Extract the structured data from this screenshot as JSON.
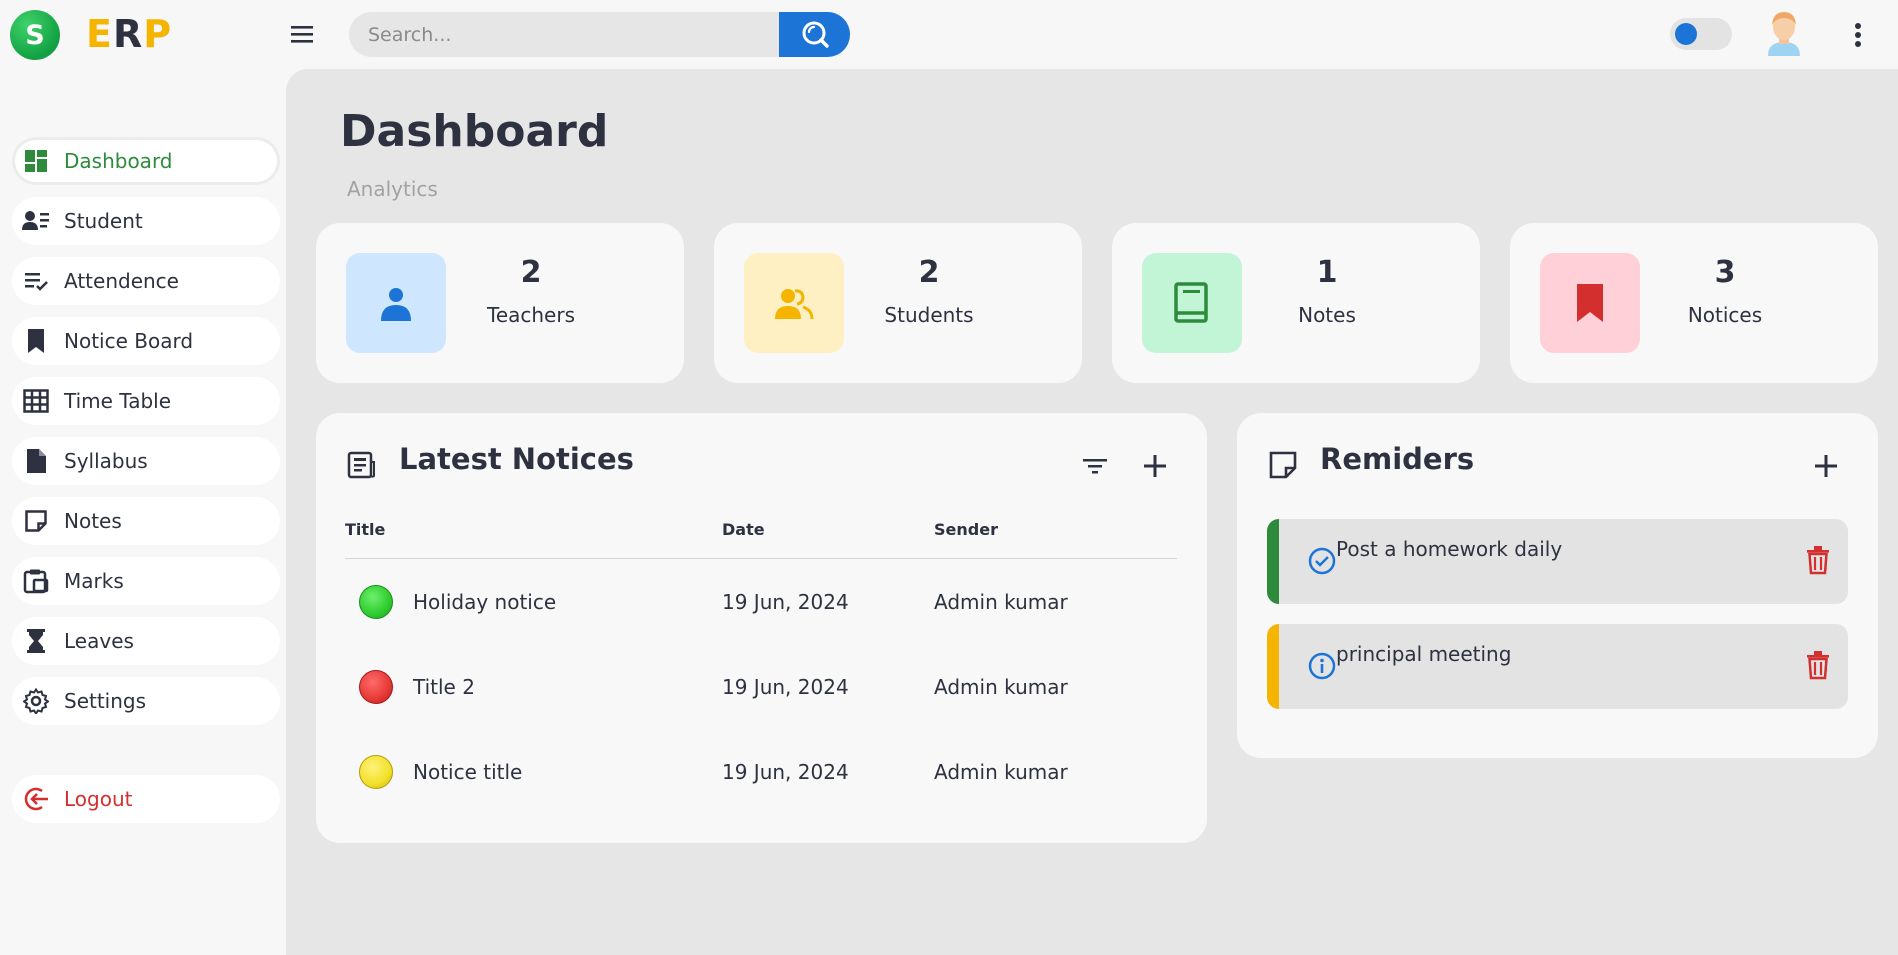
{
  "brand": {
    "logo_letter": "S",
    "name_e": "E",
    "name_r": "R",
    "name_p": "P"
  },
  "search": {
    "placeholder": "Search..."
  },
  "sidebar": {
    "items": [
      {
        "label": "Dashboard",
        "icon": "dashboard-icon",
        "active": true
      },
      {
        "label": "Student",
        "icon": "student-list-icon"
      },
      {
        "label": "Attendence",
        "icon": "checklist-icon"
      },
      {
        "label": "Notice Board",
        "icon": "bookmark-icon"
      },
      {
        "label": "Time Table",
        "icon": "table-icon"
      },
      {
        "label": "Syllabus",
        "icon": "document-icon"
      },
      {
        "label": "Notes",
        "icon": "sticky-note-icon"
      },
      {
        "label": "Marks",
        "icon": "clipboard-icon"
      },
      {
        "label": "Leaves",
        "icon": "hourglass-icon"
      },
      {
        "label": "Settings",
        "icon": "gear-icon"
      }
    ],
    "logout": {
      "label": "Logout",
      "icon": "logout-icon"
    }
  },
  "page": {
    "title": "Dashboard",
    "subtitle": "Analytics"
  },
  "stats": [
    {
      "value": "2",
      "label": "Teachers",
      "icon": "person-icon",
      "bg": "#cfe6ff",
      "fg": "#1d74d7"
    },
    {
      "value": "2",
      "label": "Students",
      "icon": "group-icon",
      "bg": "#fff0c4",
      "fg": "#f4b400"
    },
    {
      "value": "1",
      "label": "Notes",
      "icon": "book-icon",
      "bg": "#c1f5d5",
      "fg": "#2e8b3b"
    },
    {
      "value": "3",
      "label": "Notices",
      "icon": "bookmark-icon",
      "bg": "#ffd0d8",
      "fg": "#d32f2f"
    }
  ],
  "notices": {
    "title": "Latest Notices",
    "columns": {
      "title": "Title",
      "date": "Date",
      "sender": "Sender"
    },
    "rows": [
      {
        "title": "Holiday notice",
        "date": "19 Jun, 2024",
        "sender": "Admin kumar",
        "status_color": "#2ecc2e"
      },
      {
        "title": "Title 2",
        "date": "19 Jun, 2024",
        "sender": "Admin kumar",
        "status_color": "#e53935"
      },
      {
        "title": "Notice title",
        "date": "19 Jun, 2024",
        "sender": "Admin kumar",
        "status_color": "#f2e02a"
      }
    ]
  },
  "reminders": {
    "title": "Remiders",
    "items": [
      {
        "text": "Post a homework daily",
        "icon": "check-circle-icon",
        "accent": "#2e8b3b"
      },
      {
        "text": "principal meeting",
        "icon": "info-circle-icon",
        "accent": "#f4b400"
      }
    ]
  },
  "colors": {
    "primary": "#1d74d7",
    "active_text": "#2e8b3b",
    "danger": "#d32f2f"
  }
}
